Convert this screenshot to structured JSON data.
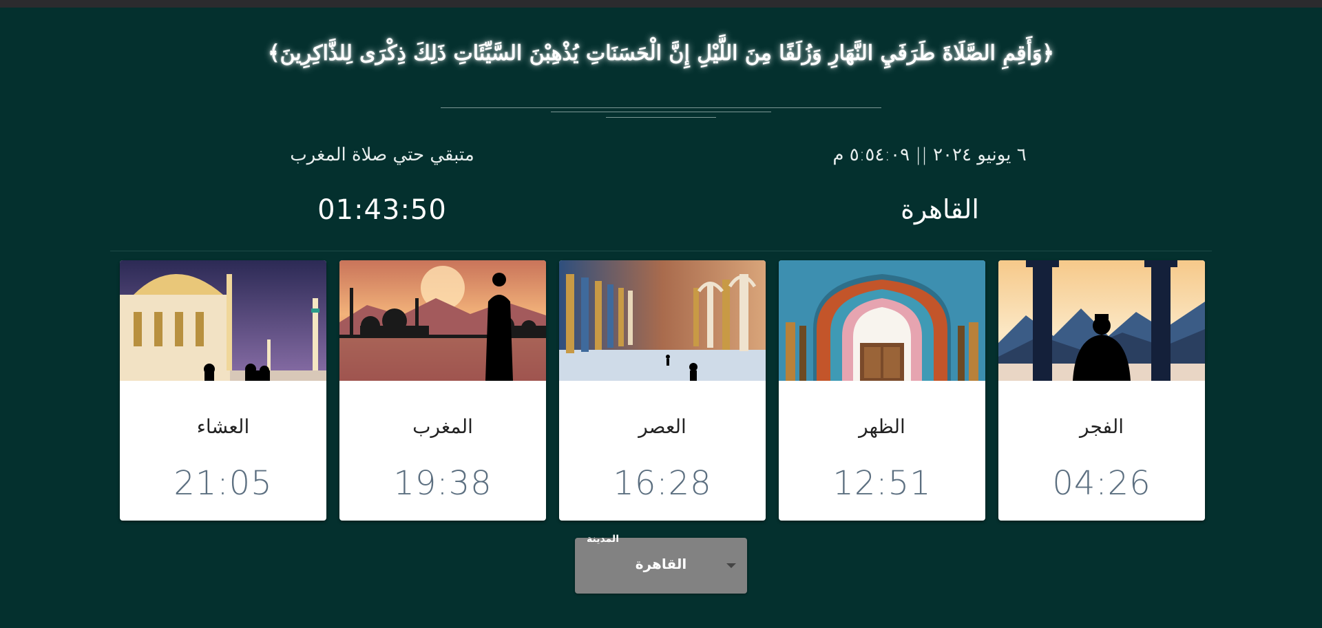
{
  "verse": "﴿وَأَقِمِ الصَّلَاةَ طَرَفَيِ النَّهَارِ وَزُلَفًا مِنَ اللَّيْلِ إِنَّ الْحَسَنَاتِ يُذْهِبْنَ السَّيِّئَاتِ ذَلِكَ ذِكْرَى لِلذَّاكِرِينَ﴾",
  "header": {
    "date_time": "٦ يونيو ٢٠٢٤ || ٥:٥٤:٠٩ م",
    "remaining_label": "متبقي حتي صلاة المغرب",
    "city": "القاهرة",
    "countdown": "01:43:50"
  },
  "prayers": [
    {
      "name": "الفجر",
      "time": "04:26",
      "image": "dawn-prayer-image"
    },
    {
      "name": "الظهر",
      "time": "12:51",
      "image": "mosque-arch-image"
    },
    {
      "name": "العصر",
      "time": "16:28",
      "image": "colonnade-image"
    },
    {
      "name": "المغرب",
      "time": "19:38",
      "image": "sunset-mosque-image"
    },
    {
      "name": "العشاء",
      "time": "21:05",
      "image": "night-mosque-image"
    }
  ],
  "city_select": {
    "label": "المدينة",
    "value": "القاهرة"
  }
}
